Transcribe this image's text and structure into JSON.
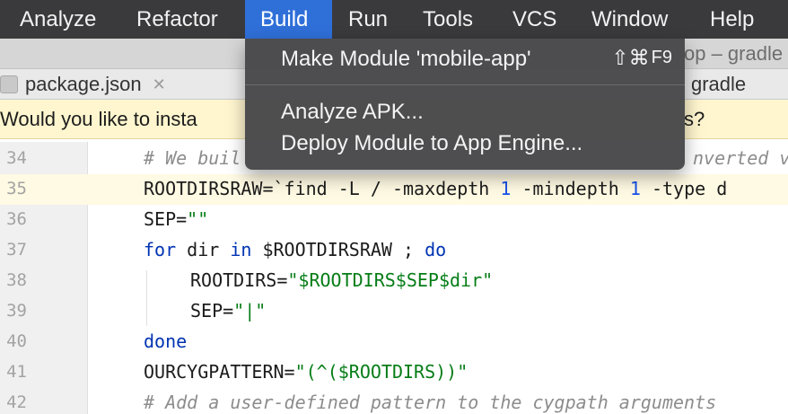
{
  "menubar": {
    "items": [
      "Analyze",
      "Refactor",
      "Build",
      "Run",
      "Tools",
      "VCS",
      "Window",
      "Help"
    ],
    "active": "Build"
  },
  "window": {
    "title_fragment": "op – gradle"
  },
  "tabs": {
    "left_tab": "package.json",
    "right_tab": "gradle"
  },
  "notification": {
    "text_start": "Would you like to insta",
    "text_end": "s?"
  },
  "build_menu": {
    "make_module": "Make Module 'mobile-app'",
    "make_module_shortcut": "⇧⌘",
    "make_module_fkey": "F9",
    "analyze_apk": "Analyze APK...",
    "deploy_module": "Deploy Module to App Engine..."
  },
  "editor": {
    "current_line": 35,
    "line_numbers": [
      "34",
      "35",
      "36",
      "37",
      "38",
      "39",
      "40",
      "41",
      "42"
    ],
    "line34_comment_start": "# We buil",
    "line34_comment_end": "nverted v",
    "line35_var": "ROOTDIRSRAW=`find -L / -maxdepth ",
    "line35_num1": "1",
    "line35_mid": " -mindepth ",
    "line35_num2": "1",
    "line35_end": " -type d",
    "line36_var": "SEP=",
    "line36_str": "\"\"",
    "line37_for": "for",
    "line37_mid": " dir ",
    "line37_in": "in",
    "line37_rest": " $ROOTDIRSRAW ; ",
    "line37_do": "do",
    "line38_var": "ROOTDIRS=",
    "line38_str": "\"$ROOTDIRS$SEP$dir\"",
    "line39_var": "SEP=",
    "line39_str": "\"|\"",
    "line40_done": "done",
    "line41_var": "OURCYGPATTERN=",
    "line41_str": "\"(^($ROOTDIRS))\"",
    "line42_comment": "# Add a user-defined pattern to the cygpath arguments"
  }
}
